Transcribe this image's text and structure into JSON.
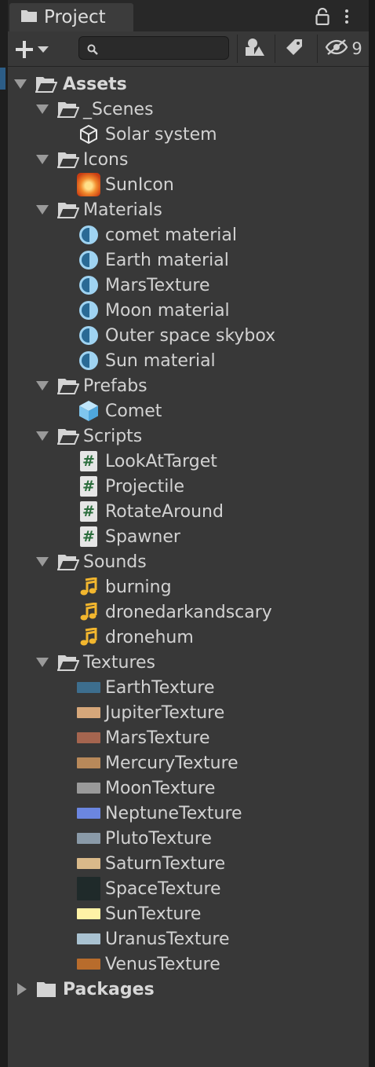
{
  "tab": {
    "title": "Project"
  },
  "toolbar": {
    "search_placeholder": "",
    "hidden_count": "9"
  },
  "tree": {
    "assets": "Assets",
    "scenes_folder": "_Scenes",
    "scene_solar": "Solar system",
    "icons_folder": "Icons",
    "sun_icon": "SunIcon",
    "materials_folder": "Materials",
    "materials": [
      "comet material",
      "Earth material",
      "MarsTexture",
      "Moon material",
      "Outer space skybox",
      "Sun material"
    ],
    "prefabs_folder": "Prefabs",
    "prefab_comet": "Comet",
    "scripts_folder": "Scripts",
    "scripts": [
      "LookAtTarget",
      "Projectile",
      "RotateAround",
      "Spawner"
    ],
    "sounds_folder": "Sounds",
    "sounds": [
      "burning",
      "dronedarkandscary",
      "dronehum"
    ],
    "textures_folder": "Textures",
    "textures": [
      "EarthTexture",
      "JupiterTexture",
      "MarsTexture",
      "MercuryTexture",
      "MoonTexture",
      "NeptuneTexture",
      "PlutoTexture",
      "SaturnTexture",
      "SpaceTexture",
      "SunTexture",
      "UranusTexture",
      "VenusTexture"
    ],
    "texture_colors": [
      "#3d6e8e",
      "#d6a77a",
      "#a5654f",
      "#b8895a",
      "#9a9a9a",
      "#6b86e0",
      "#8a9aa8",
      "#d9b98a",
      "#1f2a2a",
      "#fff2a6",
      "#a9c2d1",
      "#b86c2c"
    ],
    "packages": "Packages"
  },
  "colors": {
    "panel": "#383838",
    "script_hash": "#2b6d3c",
    "material": "#9fd3f1",
    "audio": "#f2b62e"
  }
}
